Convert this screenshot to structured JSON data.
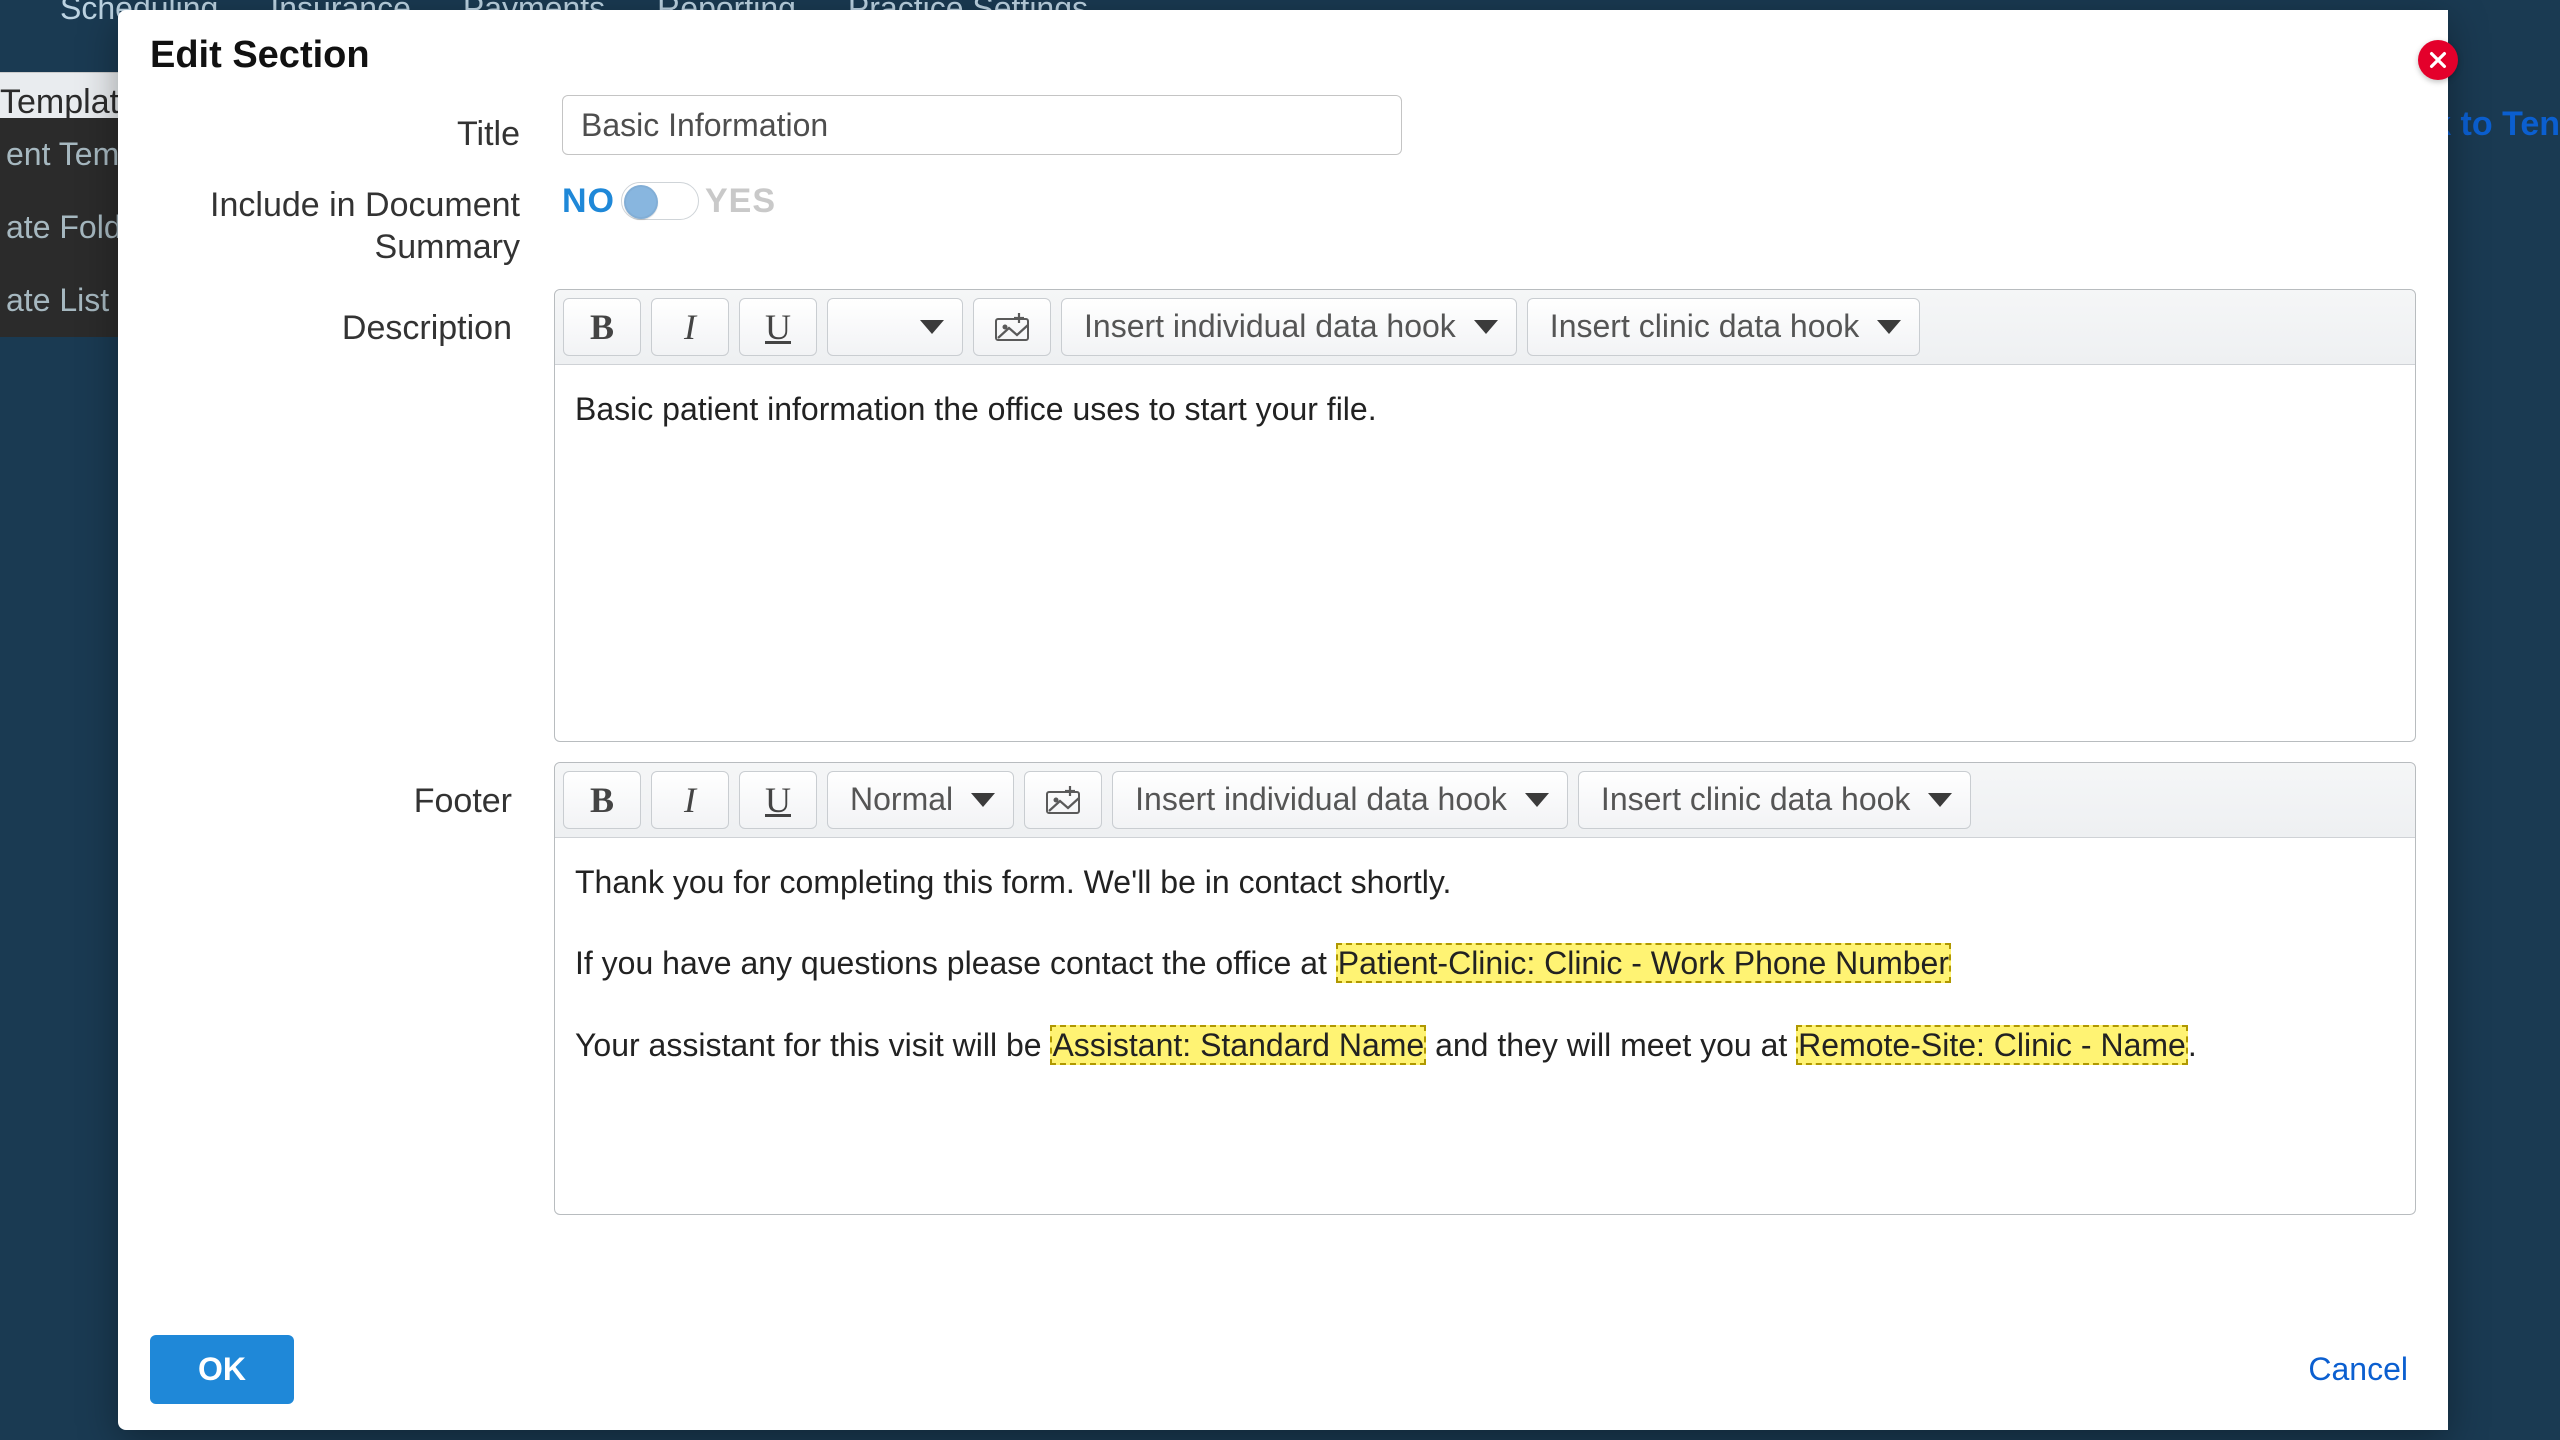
{
  "chrome": {
    "topnav": [
      "Scheduling",
      "Insurance",
      "Payments",
      "Reporting",
      "Practice Settings"
    ],
    "templates_tab": "Templates",
    "sidebar": [
      "ent Templ",
      "ate Folde",
      "ate List"
    ],
    "right_link": "ck to Ten"
  },
  "modal": {
    "title": "Edit Section",
    "labels": {
      "title": "Title",
      "include_summary": "Include in Document Summary",
      "description": "Description",
      "footer": "Footer"
    },
    "title_value": "Basic Information",
    "toggle": {
      "no": "NO",
      "yes": "YES",
      "state": "no"
    },
    "toolbar": {
      "style_select_empty": "",
      "style_select_normal": "Normal",
      "individual_hook": "Insert individual data hook",
      "clinic_hook": "Insert clinic data hook"
    },
    "description_body": "Basic patient information the office uses to start your file.",
    "footer_body": {
      "p1": "Thank you for completing this form. We'll be in contact shortly.",
      "p2_pre": "If you have any questions please contact the office at ",
      "p2_hook": "Patient-Clinic: Clinic - Work Phone Number",
      "p3_pre": "Your assistant for this visit will be ",
      "p3_hook1": "Assistant: Standard Name",
      "p3_mid": " and they will meet you at ",
      "p3_hook2": "Remote-Site: Clinic - Name",
      "p3_post": "."
    },
    "ok": "OK",
    "cancel": "Cancel"
  }
}
